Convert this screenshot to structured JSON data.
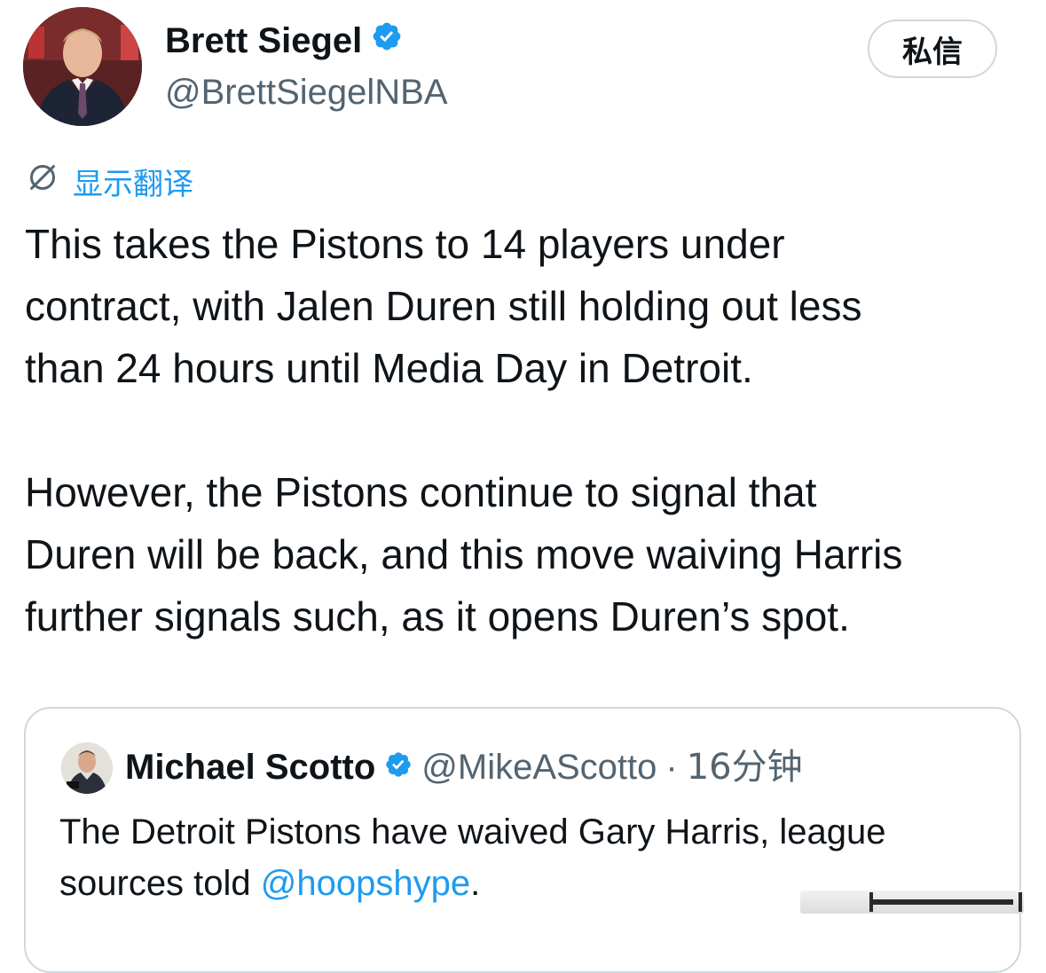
{
  "author": {
    "name": "Brett Siegel",
    "handle": "@BrettSiegelNBA",
    "verified": true
  },
  "actions": {
    "dm_label": "私信"
  },
  "translate": {
    "label": "显示翻译",
    "icon": "globe-icon"
  },
  "tweet": {
    "text": "This takes the Pistons to 14 players under\ncontract, with Jalen Duren still holding out less\nthan 24 hours until Media Day in Detroit.\n\nHowever, the Pistons continue to signal that\nDuren will be back, and this move waiving Harris\nfurther signals such, as it opens Duren’s spot."
  },
  "quoted": {
    "name": "Michael Scotto",
    "handle": "@MikeAScotto",
    "separator": "·",
    "time": "16分钟",
    "verified": true,
    "text_before": "The Detroit Pistons have waived Gary Harris, league sources told ",
    "mention": "@hoopshype",
    "text_after": "."
  },
  "colors": {
    "accent": "#1d9bf0",
    "secondary_text": "#536471",
    "border": "#cfd9de"
  }
}
